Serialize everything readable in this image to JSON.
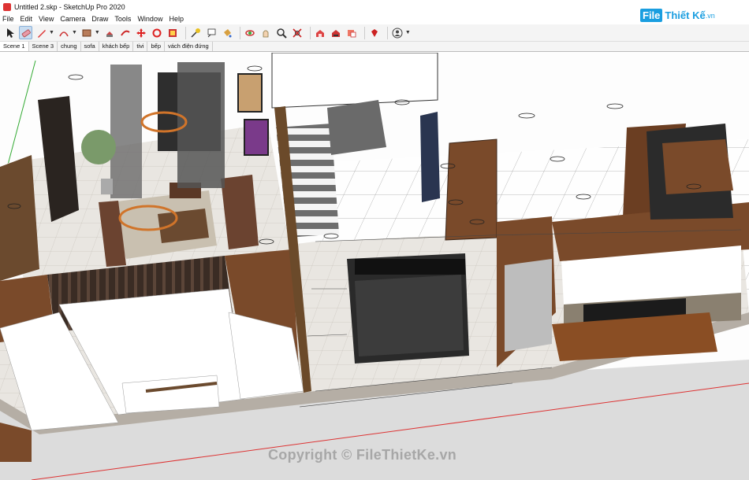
{
  "window": {
    "title": "Untitled 2.skp - SketchUp Pro 2020"
  },
  "menu": [
    "File",
    "Edit",
    "View",
    "Camera",
    "Draw",
    "Tools",
    "Window",
    "Help"
  ],
  "toolbar": {
    "tools": [
      "select-icon",
      "eraser-icon",
      "pencil-icon",
      "arc-icon",
      "rectangle-icon",
      "push-pull-icon",
      "follow-me-icon",
      "move-icon",
      "rotate-icon",
      "offset-icon",
      "tape-measure-icon",
      "text-icon",
      "paint-bucket-icon",
      "orbit-icon",
      "pan-icon",
      "zoom-icon",
      "zoom-extents-icon",
      "warehouse-icon",
      "extension-warehouse-icon",
      "layout-icon",
      "ruby-icon",
      "account-icon"
    ],
    "active": "eraser-icon"
  },
  "scenes": {
    "tabs": [
      "Scene 1",
      "Scene 3",
      "chung",
      "sofa",
      "khách bếp",
      "tivi",
      "bếp",
      "vách điện đứng"
    ],
    "active": "Scene 1"
  },
  "brand": {
    "box": "File",
    "name": "Thiết Kế",
    "domain": ".vn"
  },
  "watermark": "Copyright © FileThietKe.vn",
  "colors": {
    "accent": "#1a9ee0",
    "wood": "#7a4a2a",
    "floor": "#e8e4de"
  }
}
